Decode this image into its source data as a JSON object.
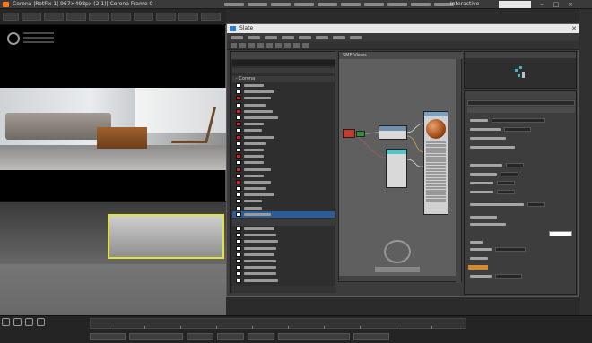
{
  "app": {
    "title": "Corona   |RetFix 1| 967×498px (2:1)| Corona   Frame 0",
    "menu_interactive": "Interactive",
    "accent_orange": "#ff7a1a"
  },
  "vfb": {
    "label": "Corona"
  },
  "slate": {
    "title": "Slate",
    "view_tab": "SME Views"
  }
}
